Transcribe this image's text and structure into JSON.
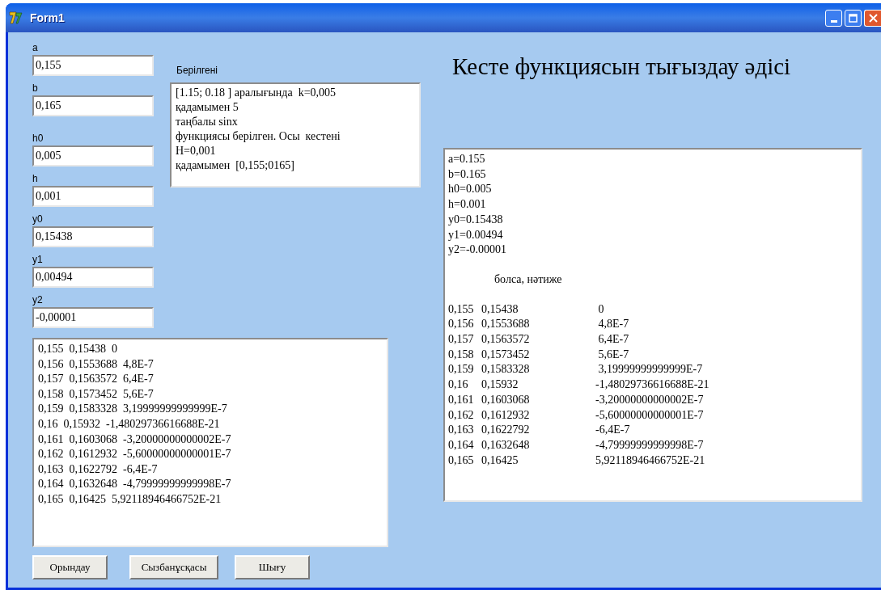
{
  "window": {
    "title": "Form1"
  },
  "fields": [
    {
      "label": "a",
      "value": "0,155"
    },
    {
      "label": "b",
      "value": "0,165"
    },
    {
      "label": "h0",
      "value": "0,005"
    },
    {
      "label": "h",
      "value": "0,001"
    },
    {
      "label": "y0",
      "value": "0,15438"
    },
    {
      "label": "y1",
      "value": "0,00494"
    },
    {
      "label": "y2",
      "value": "-0,00001"
    }
  ],
  "given": {
    "label": "Берілгені",
    "lines": [
      "[1.15; 0.18 ] аралығында  k=0,005",
      "қадамымен 5",
      "таңбалы sinx",
      "функциясы берілген. Осы  кестені",
      "H=0,001",
      "қадамымен  [0,155;0165]"
    ]
  },
  "heading": "Кесте функциясын тығыздау әдісі",
  "results_left": [
    "0,155  0,15438  0",
    "0,156  0,1553688  4,8E-7",
    "0,157  0,1563572  6,4E-7",
    "0,158  0,1573452  5,6E-7",
    "0,159  0,1583328  3,19999999999999E-7",
    "0,16  0,15932  -1,48029736616688E-21",
    "0,161  0,1603068  -3,20000000000002E-7",
    "0,162  0,1612932  -5,60000000000001E-7",
    "0,163  0,1622792  -6,4E-7",
    "0,164  0,1632648  -4,79999999999998E-7",
    "0,165  0,16425  5,92118946466752E-21"
  ],
  "results_right": {
    "params": [
      "a=0.155",
      "b=0.165",
      "h0=0.005",
      "h=0.001",
      "y0=0.15438",
      "y1=0.00494",
      "y2=-0.00001"
    ],
    "caption": "болса, нәтиже",
    "rows": [
      [
        "0,155",
        "0,15438",
        " 0"
      ],
      [
        "0,156",
        "0,1553688",
        " 4,8E-7"
      ],
      [
        "0,157",
        "0,1563572",
        " 6,4E-7"
      ],
      [
        "0,158",
        "0,1573452",
        " 5,6E-7"
      ],
      [
        "0,159",
        "0,1583328",
        " 3,19999999999999E-7"
      ],
      [
        "0,16",
        "0,15932",
        "-1,48029736616688E-21"
      ],
      [
        "0,161",
        "0,1603068",
        "-3,20000000000002E-7"
      ],
      [
        "0,162",
        "0,1612932",
        "-5,60000000000001E-7"
      ],
      [
        "0,163",
        "0,1622792",
        "-6,4E-7"
      ],
      [
        "0,164",
        "0,1632648",
        "-4,79999999999998E-7"
      ],
      [
        "0,165",
        "0,16425",
        "5,92118946466752E-21"
      ]
    ]
  },
  "buttons": [
    "Орындау",
    "Сызбанұсқасы",
    "Шығу"
  ]
}
